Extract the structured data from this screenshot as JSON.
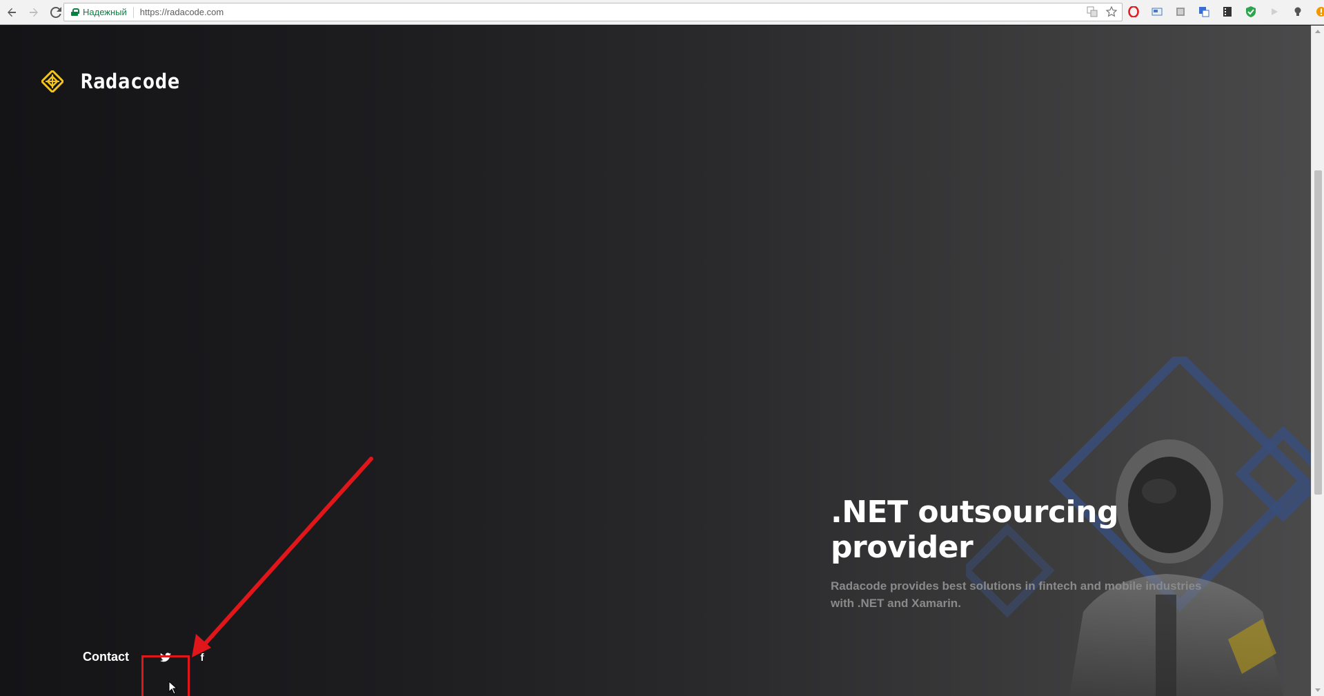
{
  "browser": {
    "security_label": "Надежный",
    "url": "https://radacode.com"
  },
  "site": {
    "brand": "Radacode",
    "hero": {
      "title": ".NET outsourcing provider",
      "subtitle": "Radacode provides best solutions in fintech and mobile industries with .NET and Xamarin."
    },
    "footer": {
      "contact_label": "Contact",
      "facebook_glyph": "f"
    }
  },
  "colors": {
    "brand_yellow": "#f2c318",
    "annotation_red": "#e0161b",
    "secure_green": "#0b8043"
  }
}
